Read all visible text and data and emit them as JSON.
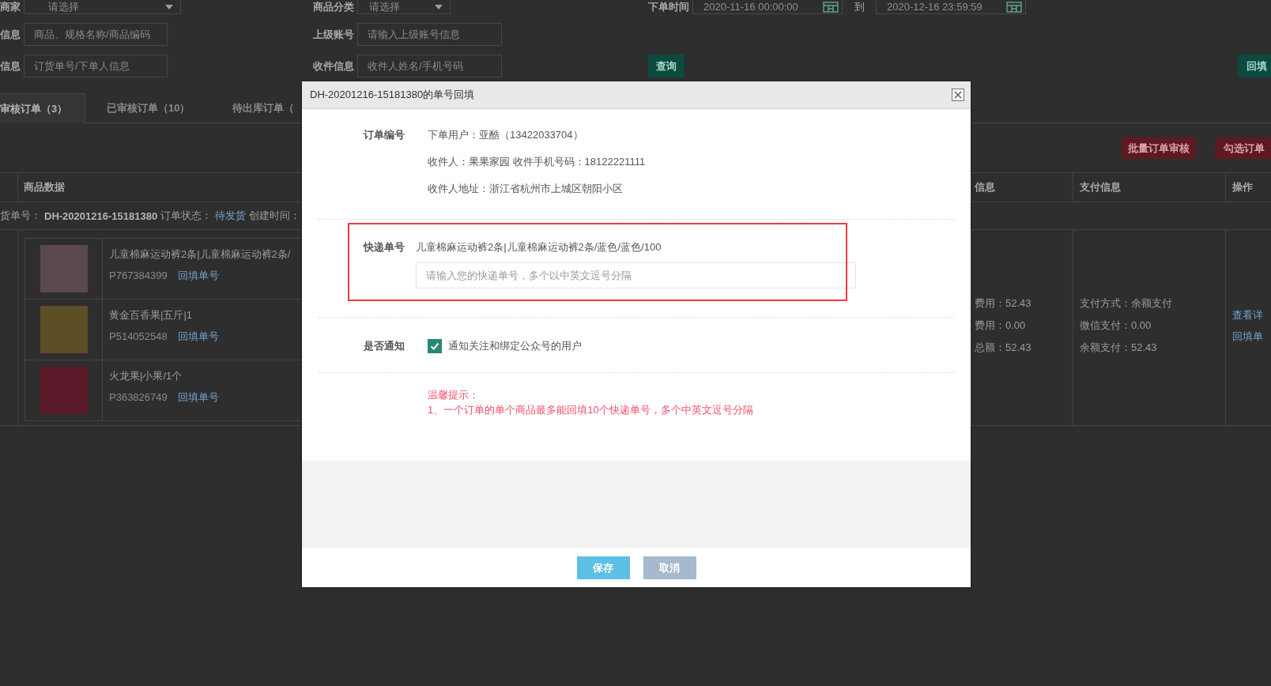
{
  "filters": {
    "rows": [
      [
        {
          "kind": "select",
          "label": "商家",
          "value": "请选择"
        },
        {
          "kind": "select",
          "label": "商品分类",
          "value": "请选择"
        },
        {
          "kind": "date_range",
          "label": "下单时间",
          "from": "2020-11-16 00:00:00",
          "separator": "到",
          "to": "2020-12-16 23:59:59"
        }
      ],
      [
        {
          "kind": "input",
          "label": "信息",
          "placeholder": "商品、规格名称/商品编码"
        },
        {
          "kind": "input",
          "label": "上级账号",
          "placeholder": "请输入上级账号信息"
        }
      ],
      [
        {
          "kind": "input",
          "label": "信息",
          "placeholder": "订货单号/下单人信息"
        },
        {
          "kind": "input",
          "label": "收件信息",
          "placeholder": "收件人姓名/手机号码"
        },
        {
          "kind": "button",
          "label": "查询"
        },
        {
          "kind": "button",
          "label": "回填"
        }
      ]
    ]
  },
  "tabs": [
    {
      "label": "审核订单（3）",
      "selected": true
    },
    {
      "label": "已审核订单（10）",
      "selected": false
    },
    {
      "label": "待出库订单（",
      "selected": false
    }
  ],
  "actions": [
    "批量订单审核",
    "勾选订单"
  ],
  "table": {
    "columns": [
      "商品数据",
      "信息",
      "支付信息",
      "操作"
    ],
    "order": {
      "number_label": "货单号：",
      "number": "DH-20201216-15181380",
      "status_label": "订单状态：",
      "status": "待发货",
      "created_label": "创建时间："
    },
    "items": [
      {
        "title": "儿童棉麻运动裤2条|儿童棉麻运动裤2条/",
        "code": "P767384399",
        "link": "回填单号"
      },
      {
        "title": "黄金百香果|五斤|1",
        "code": "P514052548",
        "link": "回填单号"
      },
      {
        "title": "火龙果|小果/1个",
        "code": "P363826749",
        "link": "回填单号"
      }
    ],
    "fees": [
      "费用：52.43",
      "费用：0.00",
      "总额：52.43"
    ],
    "payment": [
      "支付方式：余额支付",
      "微信支付：0.00",
      "余额支付：52.43"
    ],
    "operations": [
      "查看详",
      "回填单"
    ]
  },
  "dialog": {
    "title": "DH-20201216-15181380的单号回填",
    "sections": [
      {
        "kind": "info",
        "label": "订单编号",
        "lines": [
          "下单用户：亚酷（13422033704）",
          "收件人：果果家园 收件手机号码：18122221111",
          "收件人地址：浙江省杭州市上城区朝阳小区"
        ]
      },
      {
        "kind": "express",
        "label": "快递单号",
        "item": "儿童棉麻运动裤2条|儿童棉麻运动裤2条/蓝色/蓝色/100",
        "placeholder": "请输入您的快递单号，多个以中英文逗号分隔",
        "highlighted": true
      },
      {
        "kind": "notify",
        "label": "是否通知",
        "option": "通知关注和绑定公众号的用户",
        "checked": true
      },
      {
        "kind": "tip",
        "lines": [
          "温馨提示：",
          "1、一个订单的单个商品最多能回填10个快递单号，多个中英文逗号分隔"
        ]
      }
    ],
    "buttons": [
      {
        "kind": "primary",
        "label": "保存"
      },
      {
        "kind": "secondary",
        "label": "取消"
      }
    ]
  }
}
